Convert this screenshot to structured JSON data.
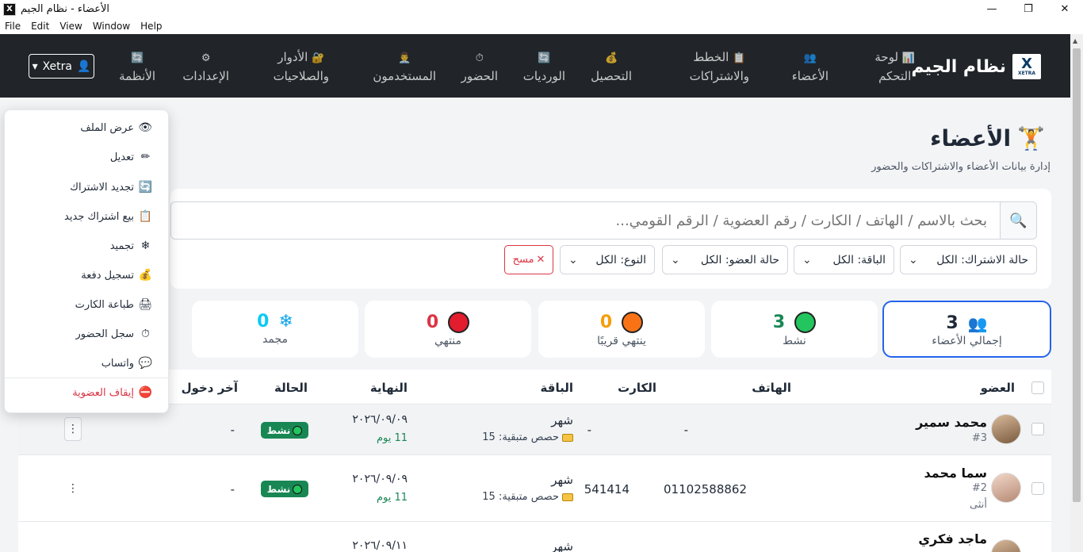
{
  "window": {
    "title": "الأعضاء - نظام الجيم",
    "icon": "X",
    "minimize": "—",
    "maximize": "❐",
    "close": "✕"
  },
  "menubar": [
    "File",
    "Edit",
    "View",
    "Window",
    "Help"
  ],
  "brand": {
    "name": "نظام الجيم",
    "logo": "X",
    "logo_sub": "XETRA"
  },
  "nav": [
    {
      "icon": "📊",
      "line1": "لوحة",
      "line2": "التحكم"
    },
    {
      "icon": "👥",
      "line1": "",
      "line2": "الأعضاء"
    },
    {
      "icon": "📋",
      "line1": "الخطط",
      "line2": "والاشتراكات"
    },
    {
      "icon": "💰",
      "line1": "",
      "line2": "التحصيل"
    },
    {
      "icon": "🔄",
      "line1": "",
      "line2": "الورديات"
    },
    {
      "icon": "⏱",
      "line1": "",
      "line2": "الحضور"
    },
    {
      "icon": "👨‍💼",
      "line1": "",
      "line2": "المستخدمون"
    },
    {
      "icon": "🔐",
      "line1": "الأدوار",
      "line2": "والصلاحيات"
    },
    {
      "icon": "⚙",
      "line1": "",
      "line2": "الإعدادات"
    },
    {
      "icon": "🔄",
      "line1": "",
      "line2": "الأنظمة"
    }
  ],
  "user_menu": {
    "label": "Xetra",
    "icon": "👤",
    "caret": "▾"
  },
  "page": {
    "icon": "🏋",
    "title": "الأعضاء",
    "subtitle": "إدارة بيانات الأعضاء والاشتراكات والحضور"
  },
  "search": {
    "placeholder": "بحث بالاسم / الهاتف / الكارت / رقم العضوية / الرقم القومي...",
    "icon": "🔍"
  },
  "filters": [
    {
      "label": "حالة الاشتراك: الكل"
    },
    {
      "label": "الباقة: الكل"
    },
    {
      "label": "حالة العضو: الكل"
    },
    {
      "label": "النوع: الكل"
    }
  ],
  "clear_button": {
    "icon": "✕",
    "label": "مسح"
  },
  "stats": [
    {
      "key": "total",
      "icon": "👥",
      "value": "3",
      "label": "إجمالي الأعضاء",
      "color": "#1f2937"
    },
    {
      "key": "active",
      "icon": "🟢",
      "value": "3",
      "label": "نشط",
      "color": "#198754"
    },
    {
      "key": "soon",
      "icon": "🟠",
      "value": "0",
      "label": "ينتهي قريبًا",
      "color": "#f59e0b"
    },
    {
      "key": "expired",
      "icon": "🔴",
      "value": "0",
      "label": "منتهي",
      "color": "#dc3545"
    },
    {
      "key": "frozen",
      "icon": "❄",
      "value": "0",
      "label": "مجمد",
      "color": "#0dcaf0"
    }
  ],
  "table": {
    "headers": {
      "member": "العضو",
      "phone": "الهاتف",
      "card": "الكارت",
      "plan": "الباقة",
      "end": "النهاية",
      "status": "الحالة",
      "last_entry": "آخر دخول"
    },
    "rows": [
      {
        "name": "محمد سمير",
        "id": "#3",
        "gender": "",
        "phone": "-",
        "card": "-",
        "plan": "شهر",
        "remaining": "حصص متبقية: 15",
        "end": "٢٠٢٦/٠٩/٠٩",
        "days": "11 يوم",
        "status": "نشط",
        "last_entry": "-"
      },
      {
        "name": "سما محمد",
        "id": "#2",
        "gender": "أنثى",
        "phone": "01102588862",
        "card": "541414",
        "plan": "شهر",
        "remaining": "حصص متبقية: 15",
        "end": "٢٠٢٦/٠٩/٠٩",
        "days": "11 يوم",
        "status": "نشط",
        "last_entry": "-"
      },
      {
        "name": "ماجد فكري",
        "id": "",
        "gender": "",
        "phone": "",
        "card": "",
        "plan": "شهر",
        "remaining": "",
        "end": "٢٠٢٦/٠٩/١١",
        "days": "",
        "status": "",
        "last_entry": ""
      }
    ]
  },
  "actions_menu": [
    {
      "icon": "👁",
      "label": "عرض الملف"
    },
    {
      "icon": "✏",
      "label": "تعديل"
    },
    {
      "icon": "🔄",
      "label": "تجديد الاشتراك"
    },
    {
      "icon": "📋",
      "label": "بيع اشتراك جديد"
    },
    {
      "icon": "❄",
      "label": "تجميد"
    },
    {
      "icon": "💰",
      "label": "تسجيل دفعة"
    },
    {
      "icon": "🖨",
      "label": "طباعة الكارت"
    },
    {
      "icon": "⏱",
      "label": "سجل الحضور"
    },
    {
      "icon": "💬",
      "label": "واتساب"
    },
    {
      "icon": "⛔",
      "label": "إيقاف العضوية",
      "danger": true
    }
  ],
  "kebab_icon": "⋮",
  "checkbox_state": false
}
